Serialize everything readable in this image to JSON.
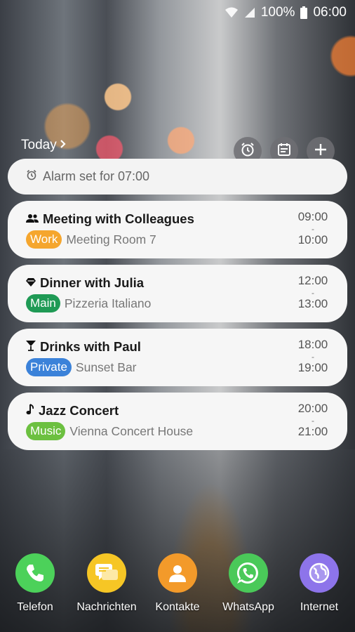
{
  "status_bar": {
    "battery": "100%",
    "time": "06:00"
  },
  "widget": {
    "today_label": "Today",
    "alarm_text": "Alarm set for 07:00",
    "events": [
      {
        "icon": "group-icon",
        "title": "Meeting with Colleagues",
        "tag": "Work",
        "tag_color": "#f5a62e",
        "location": "Meeting Room 7",
        "start": "09:00",
        "dash": "-",
        "end": "10:00"
      },
      {
        "icon": "diamond-icon",
        "title": "Dinner with Julia",
        "tag": "Main",
        "tag_color": "#1f9a55",
        "location": "Pizzeria Italiano",
        "start": "12:00",
        "dash": "-",
        "end": "13:00"
      },
      {
        "icon": "cocktail-icon",
        "title": "Drinks with Paul",
        "tag": "Private",
        "tag_color": "#3b82d9",
        "location": "Sunset Bar",
        "start": "18:00",
        "dash": "-",
        "end": "19:00"
      },
      {
        "icon": "music-note-icon",
        "title": "Jazz Concert",
        "tag": "Music",
        "tag_color": "#6cc040",
        "location": "Vienna Concert House",
        "start": "20:00",
        "dash": "-",
        "end": "21:00"
      }
    ]
  },
  "dock": {
    "apps": [
      {
        "label": "Telefon",
        "icon": "phone-icon",
        "color": "#4cd15a"
      },
      {
        "label": "Nachrichten",
        "icon": "messages-icon",
        "color": "#f6c625"
      },
      {
        "label": "Kontakte",
        "icon": "contacts-icon",
        "color": "#f39a2a"
      },
      {
        "label": "WhatsApp",
        "icon": "whatsapp-icon",
        "color": "#4ac959"
      },
      {
        "label": "Internet",
        "icon": "internet-icon",
        "color": "#8d74ea"
      }
    ]
  }
}
